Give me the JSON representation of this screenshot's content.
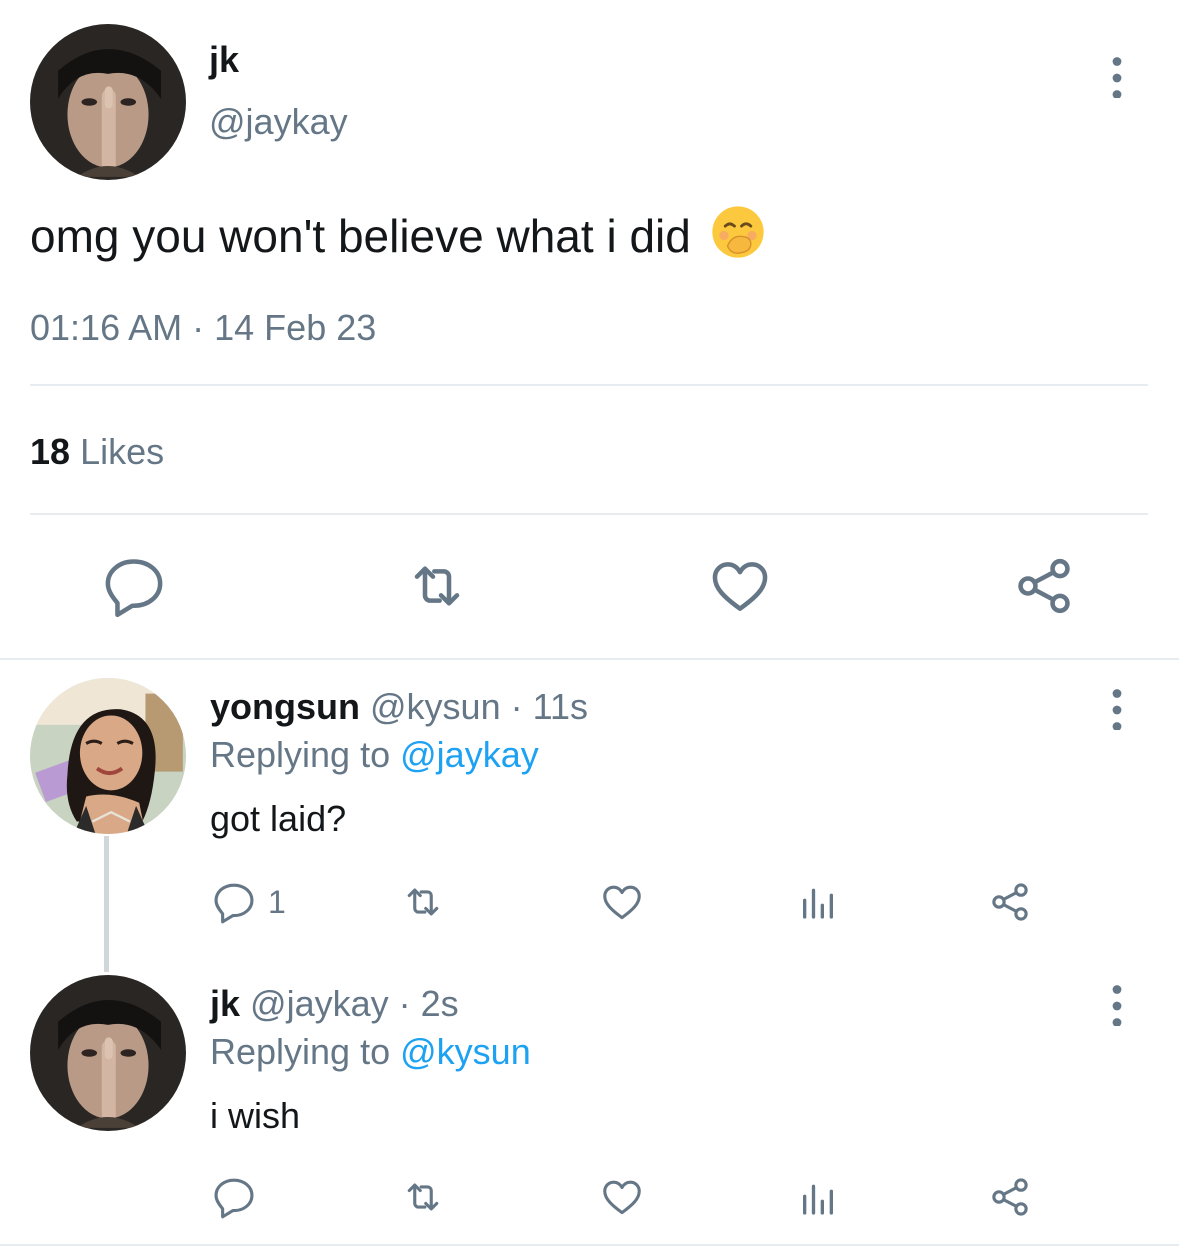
{
  "main_tweet": {
    "author_name": "jk",
    "author_handle": "@jaykay",
    "text": "omg you won't believe what i did",
    "emoji": "🤭",
    "time": "01:16 AM",
    "separator": "·",
    "date": "14 Feb 23",
    "likes_count": "18",
    "likes_label": "Likes"
  },
  "replies": [
    {
      "author_name": "yongsun",
      "author_handle": "@kysun",
      "age": "· 11s",
      "replying_prefix": "Replying to",
      "replying_handle": "@jaykay",
      "text": "got laid?",
      "reply_count": "1"
    },
    {
      "author_name": "jk",
      "author_handle": "@jaykay",
      "age": "· 2s",
      "replying_prefix": "Replying to",
      "replying_handle": "@kysun",
      "text": "i wish",
      "reply_count": ""
    }
  ],
  "colors": {
    "text": "#14171a",
    "muted": "#657786",
    "link": "#1da1f2",
    "divider": "#e6ecf0"
  },
  "icons": {
    "reply": "speech-bubble",
    "retweet": "retweet-arrows",
    "like": "heart",
    "share": "share-nodes",
    "stats": "bar-chart",
    "more": "vertical-ellipsis"
  }
}
